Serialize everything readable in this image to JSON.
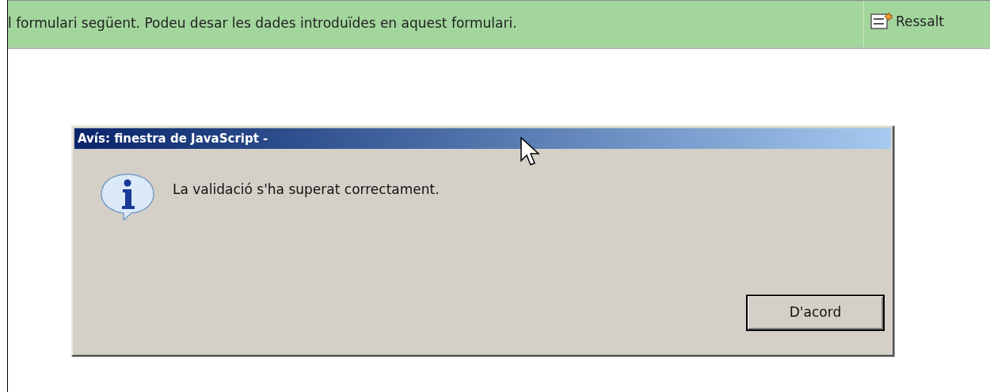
{
  "info_bar": {
    "message": "l formulari següent. Podeu desar les dades introduïdes en aquest formulari.",
    "button": "Ressalt"
  },
  "dialog": {
    "title": "Avís: finestra de JavaScript -",
    "message": "La validació s'ha superat correctament.",
    "buttons": [
      "D'acord"
    ]
  }
}
